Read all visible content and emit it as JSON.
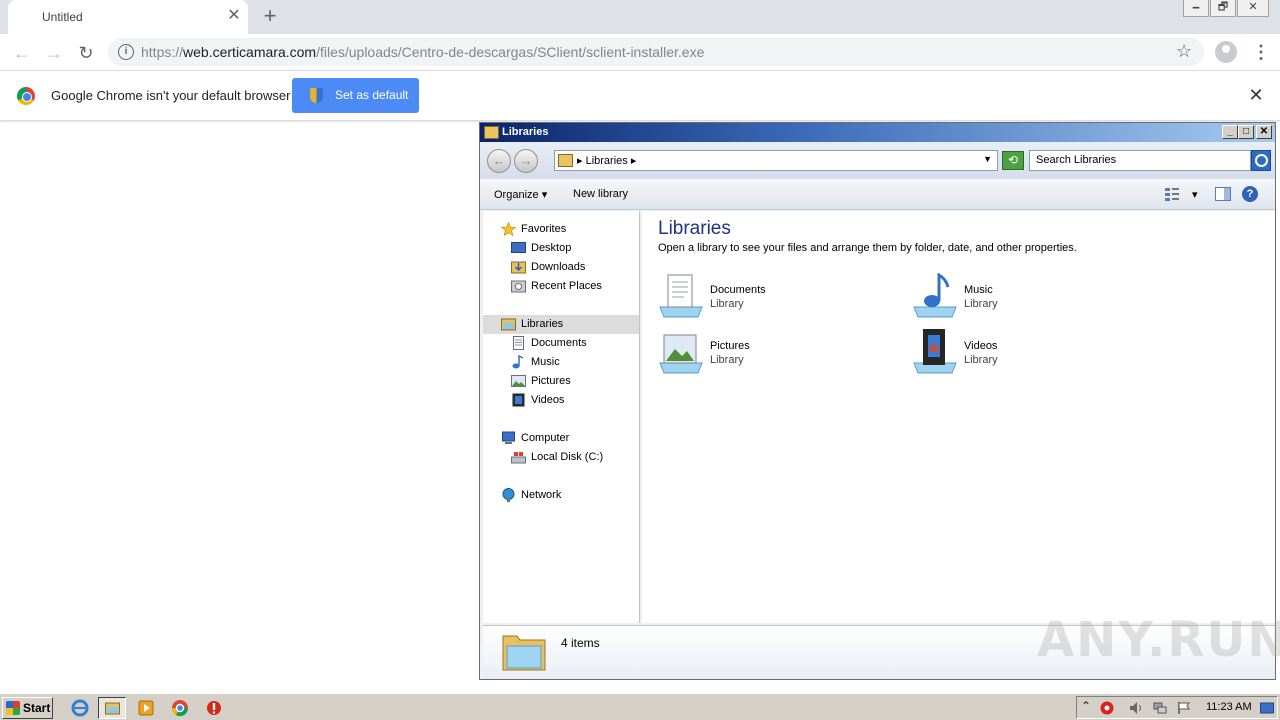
{
  "browser": {
    "tab_title": "Untitled",
    "tab_close_glyph": "✕",
    "new_tab_glyph": "+",
    "window_controls": [
      "🗕",
      "🗗",
      "✕"
    ],
    "back_glyph": "←",
    "forward_glyph": "→",
    "reload_glyph": "↻",
    "url_scheme": "https://",
    "url_host": "web.certicamara.com",
    "url_path": "/files/uploads/Centro-de-descargas/SClient/sclient-installer.exe",
    "star_glyph": "☆",
    "menu_glyph": "⋮"
  },
  "infobar": {
    "message": "Google Chrome isn't your default browser",
    "button_label": "Set as default",
    "close_glyph": "✕"
  },
  "explorer": {
    "title": "Libraries",
    "title_buttons": [
      "_",
      "□",
      "✕"
    ],
    "back_glyph": "←",
    "forward_glyph": "→",
    "address": "▸ Libraries ▸",
    "address_drop": "▼",
    "refresh_glyph": "⟲",
    "search_placeholder": "Search Libraries",
    "commands": {
      "organize": "Organize ▾",
      "new_library": "New library",
      "view_drop": "▾",
      "help": "?"
    },
    "nav": {
      "favorites": "Favorites",
      "desktop": "Desktop",
      "downloads": "Downloads",
      "recent_places": "Recent Places",
      "libraries": "Libraries",
      "documents": "Documents",
      "music": "Music",
      "pictures": "Pictures",
      "videos": "Videos",
      "computer": "Computer",
      "local_disk": "Local Disk (C:)",
      "network": "Network"
    },
    "content_title": "Libraries",
    "content_subtitle": "Open a library to see your files and arrange them by folder, date, and other properties.",
    "libraries": [
      {
        "name": "Documents",
        "type": "Library",
        "icon": "documents-library-icon"
      },
      {
        "name": "Music",
        "type": "Library",
        "icon": "music-library-icon"
      },
      {
        "name": "Pictures",
        "type": "Library",
        "icon": "pictures-library-icon"
      },
      {
        "name": "Videos",
        "type": "Library",
        "icon": "videos-library-icon"
      }
    ],
    "status": "4 items"
  },
  "watermark": "ANY.RUN",
  "taskbar": {
    "start_label": "Start",
    "tray_chevron": "⌃",
    "clock": "11:23 AM"
  },
  "colors": {
    "chrome_blue": "#4c8bf5",
    "xp_title_start": "#0a246a",
    "library_title": "#1e3287"
  }
}
